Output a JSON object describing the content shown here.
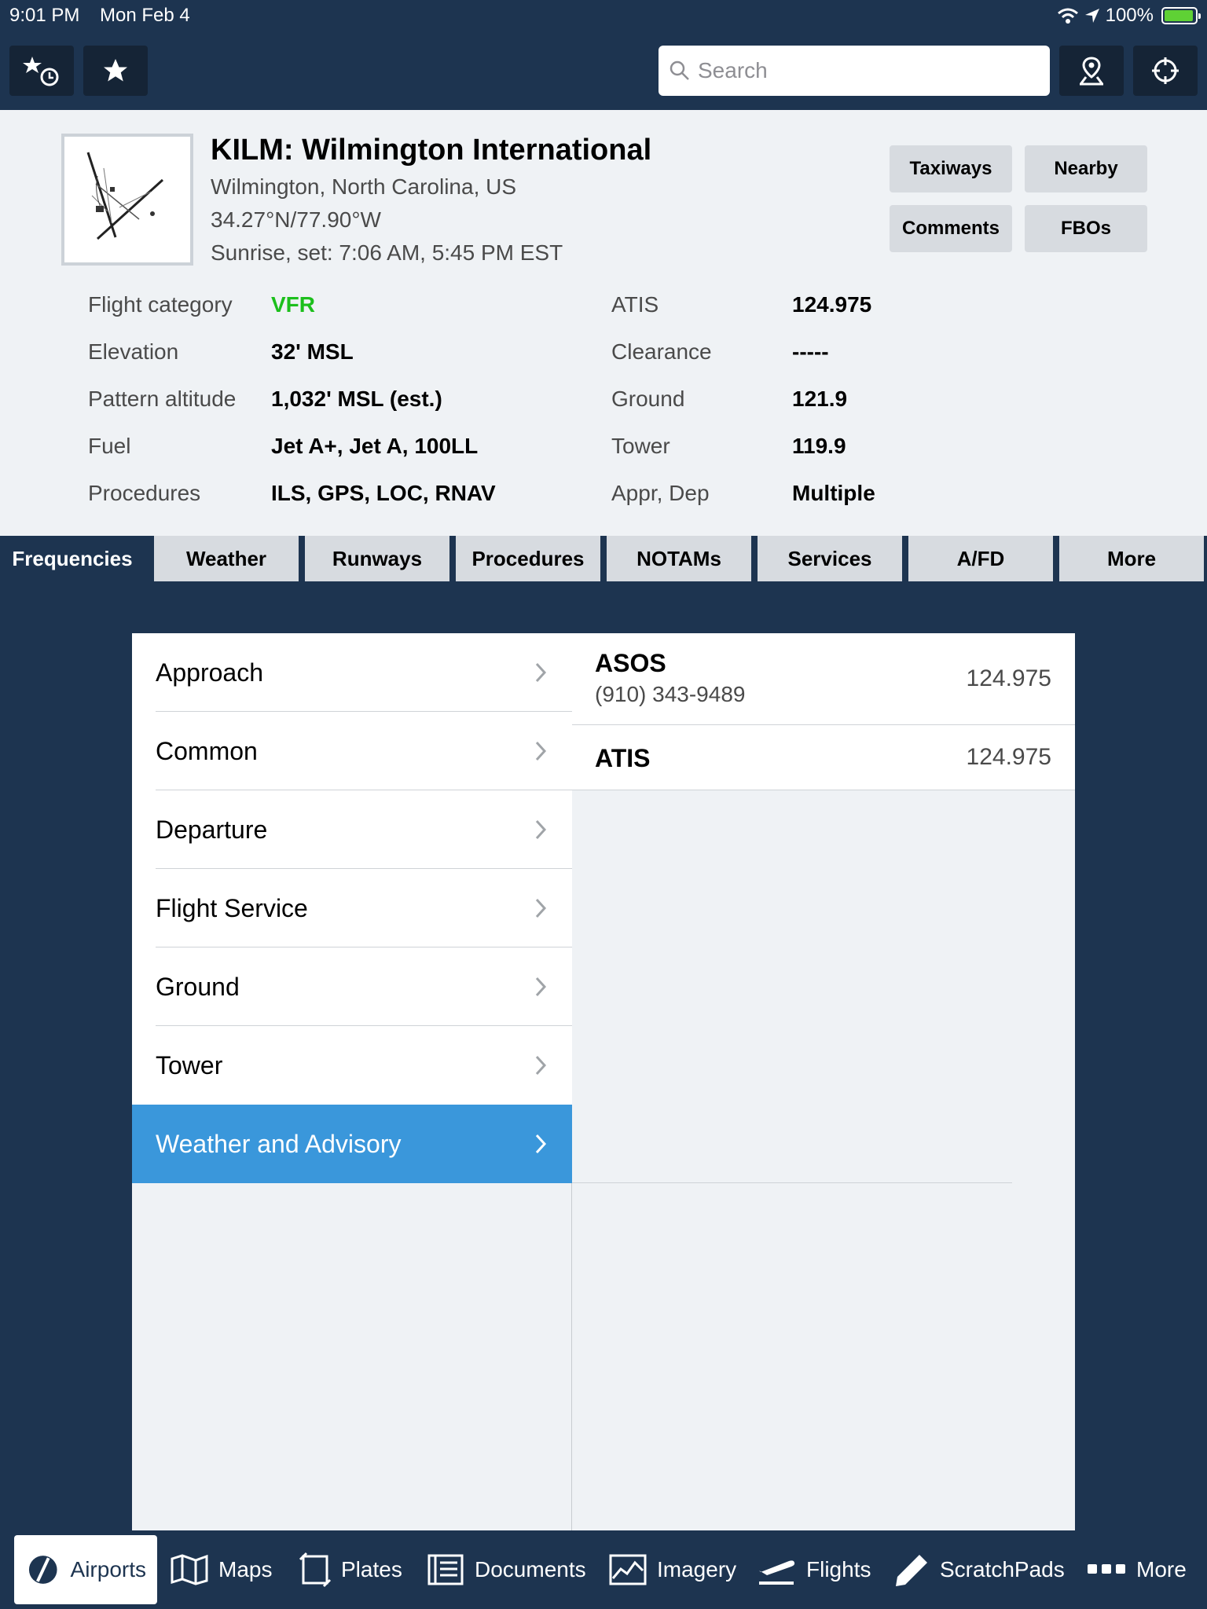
{
  "status_bar": {
    "time": "9:01 PM",
    "date": "Mon Feb 4",
    "battery": "100%"
  },
  "toolbar": {
    "search_placeholder": "Search"
  },
  "airport": {
    "title": "KILM: Wilmington International",
    "location": "Wilmington, North Carolina, US",
    "coordinates": "34.27°N/77.90°W",
    "sun": "Sunrise, set: 7:06 AM, 5:45 PM EST"
  },
  "header_buttons": {
    "taxiways": "Taxiways",
    "nearby": "Nearby",
    "comments": "Comments",
    "fbos": "FBOs"
  },
  "info_left": [
    {
      "label": "Flight category",
      "value": "VFR"
    },
    {
      "label": "Elevation",
      "value": "32' MSL"
    },
    {
      "label": "Pattern altitude",
      "value": "1,032' MSL (est.)"
    },
    {
      "label": "Fuel",
      "value": "Jet A+, Jet A, 100LL"
    },
    {
      "label": "Procedures",
      "value": "ILS, GPS, LOC, RNAV"
    }
  ],
  "info_right": [
    {
      "label": "ATIS",
      "value": "124.975"
    },
    {
      "label": "Clearance",
      "value": "-----"
    },
    {
      "label": "Ground",
      "value": "121.9"
    },
    {
      "label": "Tower",
      "value": "119.9"
    },
    {
      "label": "Appr, Dep",
      "value": "Multiple"
    }
  ],
  "tabs": [
    "Frequencies",
    "Weather",
    "Runways",
    "Procedures",
    "NOTAMs",
    "Services",
    "A/FD",
    "More"
  ],
  "categories": [
    "Approach",
    "Common",
    "Departure",
    "Flight Service",
    "Ground",
    "Tower",
    "Weather and Advisory"
  ],
  "frequencies": [
    {
      "name": "ASOS",
      "phone": "(910) 343-9489",
      "freq": "124.975"
    },
    {
      "name": "ATIS",
      "freq": "124.975"
    }
  ],
  "bottom_nav": [
    "Airports",
    "Maps",
    "Plates",
    "Documents",
    "Imagery",
    "Flights",
    "ScratchPads",
    "More"
  ],
  "colors": {
    "navy": "#1d3450",
    "vfr_green": "#1cbf1c",
    "selected_blue": "#3a97db"
  }
}
